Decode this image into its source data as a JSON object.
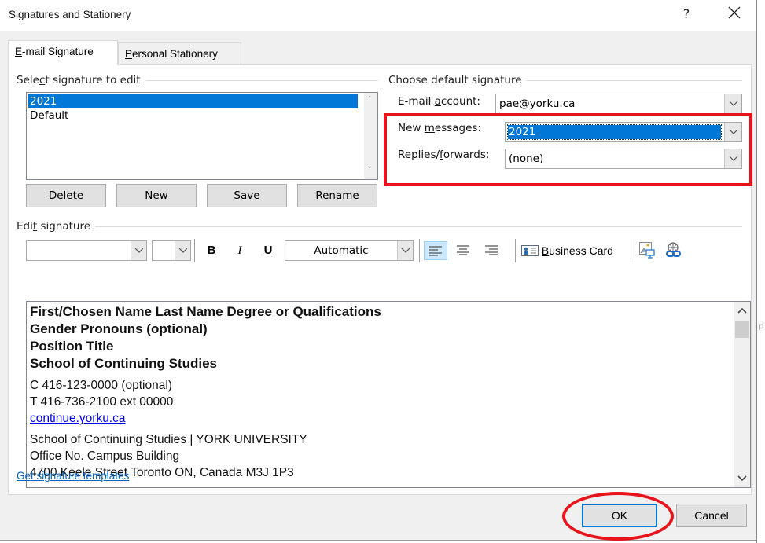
{
  "window": {
    "title": "Signatures and Stationery",
    "help_label": "?",
    "close_icon": "close-icon"
  },
  "tabs": [
    {
      "label_u": "E",
      "label_rest": "-mail Signature",
      "active": true
    },
    {
      "label_u": "P",
      "label_rest": "ersonal Stationery",
      "active": false
    }
  ],
  "select_signature": {
    "label_pre": "Sele",
    "label_u": "c",
    "label_post": "t signature to edit",
    "items": [
      "2021",
      "Default"
    ],
    "selected": "2021"
  },
  "buttons": {
    "delete": {
      "u": "D",
      "rest": "elete"
    },
    "new": {
      "u": "N",
      "rest": "ew"
    },
    "save": {
      "u": "S",
      "rest": "ave"
    },
    "rename": {
      "u": "R",
      "rest": "ename"
    }
  },
  "default_signature": {
    "group_label": "Choose default signature",
    "email_account": {
      "label_pre": "E-mail ",
      "label_u": "a",
      "label_post": "ccount:",
      "value": "pae@yorku.ca"
    },
    "new_messages": {
      "label_pre": "New ",
      "label_u": "m",
      "label_post": "essages:",
      "value": "2021"
    },
    "replies_forwards": {
      "label_pre": "Replies/",
      "label_u": "f",
      "label_post": "orwards:",
      "value": "(none)"
    }
  },
  "edit_signature": {
    "label_pre": "Edi",
    "label_u": "t",
    "label_post": " signature",
    "toolbar": {
      "font_value": "",
      "size_value": "",
      "bold_label": "B",
      "italic_label": "I",
      "underline_label": "U",
      "color_value": "Automatic",
      "business_card": {
        "u": "B",
        "rest": "usiness Card"
      },
      "alignment": "left"
    },
    "content": {
      "bold_lines": [
        "First/Chosen Name Last Name Degree or Qualifications",
        "Gender Pronouns (optional)",
        "Position Title",
        "School of Continuing Studies"
      ],
      "phone_lines": [
        "C 416-123-0000 (optional)",
        "T 416-736-2100 ext 00000"
      ],
      "website": "continue.yorku.ca",
      "address_lines": [
        "School of Continuing Studies | YORK UNIVERSITY",
        "Office No. Campus Building",
        "4700 Keele Street Toronto ON, Canada M3J 1P3"
      ]
    }
  },
  "templates_link": "Get signature templates",
  "footer": {
    "ok_label": "OK",
    "cancel_label": "Cancel"
  },
  "annotation_color": "#e8131b",
  "accent_color": "#0078d7"
}
